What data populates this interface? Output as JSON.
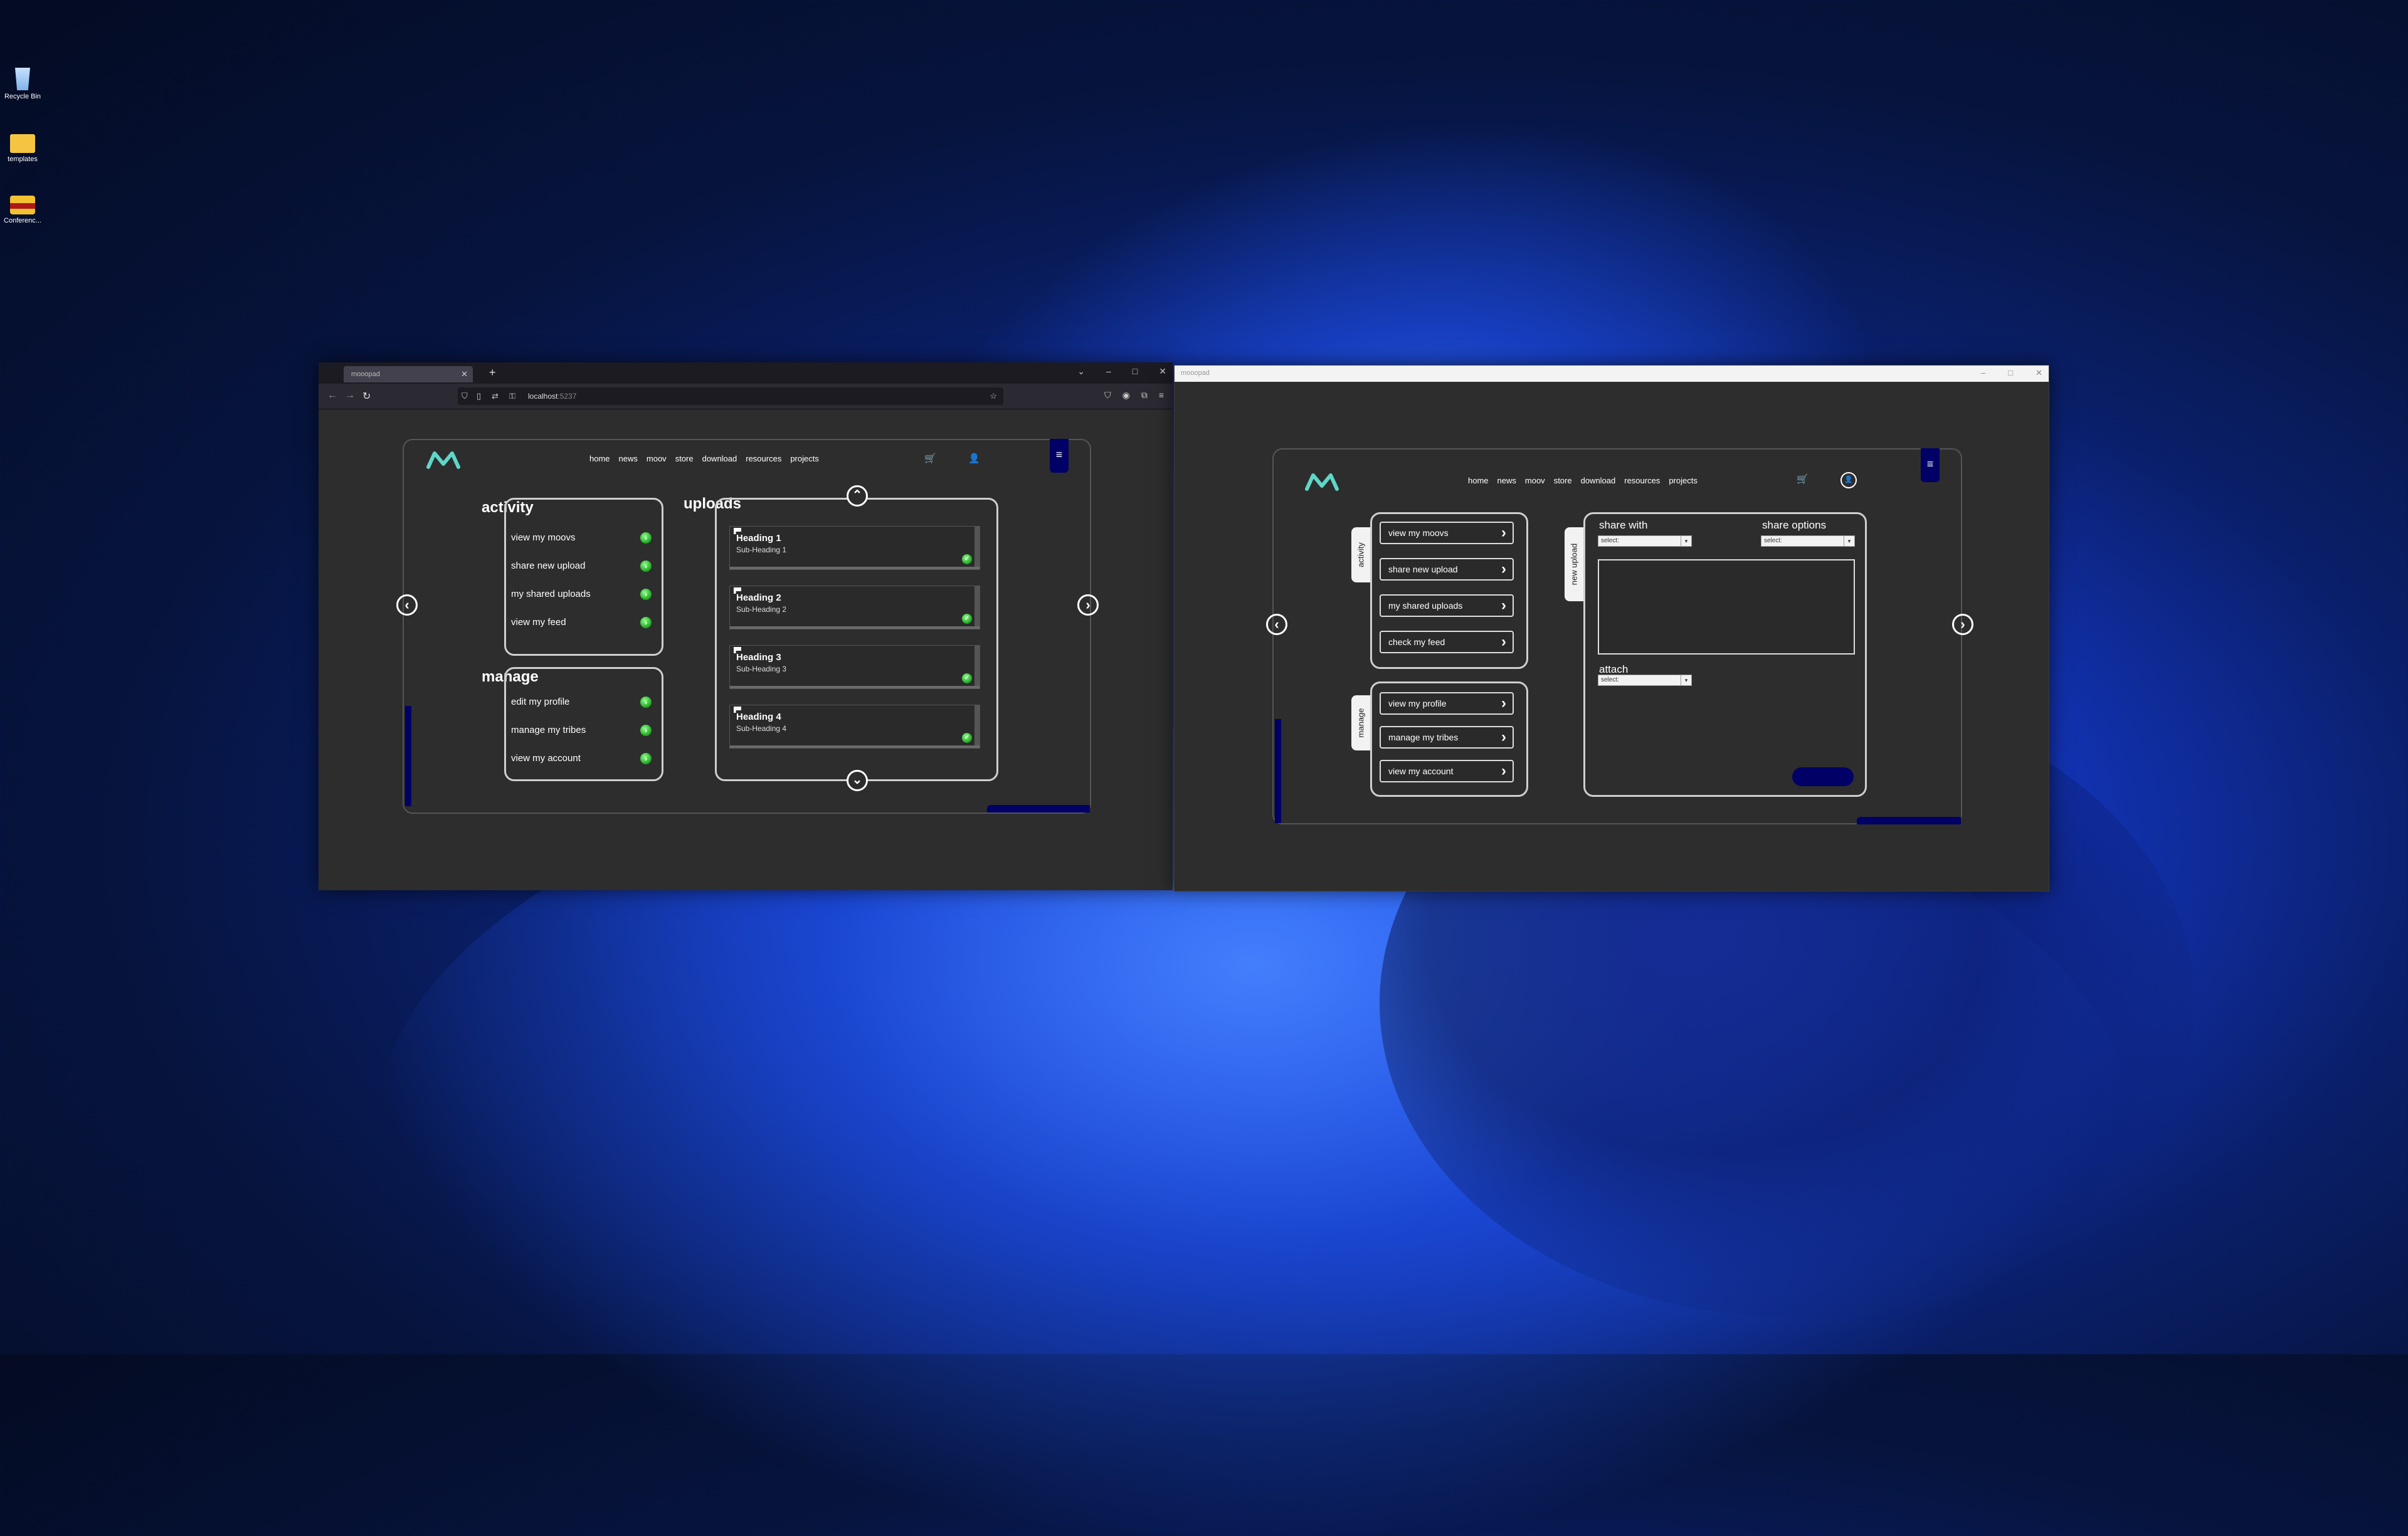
{
  "desktop": {
    "icons": [
      {
        "label": "Recycle Bin"
      },
      {
        "label": "templates"
      },
      {
        "label": "Conferenc..."
      }
    ]
  },
  "browser": {
    "tab_title": "mooopad",
    "url_host": "localhost",
    "url_port": ":5237"
  },
  "window2": {
    "title": "mooopad"
  },
  "nav": {
    "items": [
      "home",
      "news",
      "moov",
      "store",
      "download",
      "resources",
      "projects"
    ]
  },
  "dashboard": {
    "activity": {
      "title": "activity",
      "items": [
        "view my moovs",
        "share new upload",
        "my shared uploads",
        "view my feed"
      ]
    },
    "manage": {
      "title": "manage",
      "items": [
        "edit my profile",
        "manage my tribes",
        "view my account"
      ]
    },
    "uploads": {
      "title": "uploads",
      "cards": [
        {
          "heading": "Heading 1",
          "sub": "Sub-Heading 1"
        },
        {
          "heading": "Heading 2",
          "sub": "Sub-Heading 2"
        },
        {
          "heading": "Heading 3",
          "sub": "Sub-Heading 3"
        },
        {
          "heading": "Heading 4",
          "sub": "Sub-Heading 4"
        }
      ]
    }
  },
  "upload_page": {
    "activity_tab": "activity",
    "manage_tab": "manage",
    "new_upload_tab": "new upload",
    "activity_buttons": [
      "view my moovs",
      "share new upload",
      "my shared uploads",
      "check my feed"
    ],
    "manage_buttons": [
      "view my profile",
      "manage my tribes",
      "view my account"
    ],
    "share_with_label": "share with",
    "share_options_label": "share options",
    "attach_label": "attach",
    "select_placeholder": "select:"
  },
  "colors": {
    "accent_navy": "#000066",
    "logo_teal": "#5fd6c8",
    "go_green": "#1ea31e"
  }
}
